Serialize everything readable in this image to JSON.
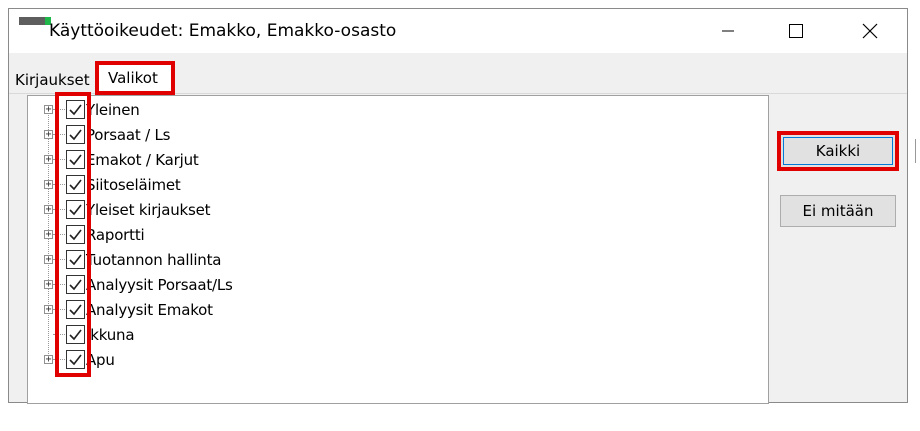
{
  "window": {
    "title": "Käyttöoikeudet: Emakko, Emakko-osasto",
    "buttons": {
      "minimize_icon": "minimize-icon",
      "maximize_icon": "maximize-icon",
      "close_icon": "close-icon"
    }
  },
  "tabs": [
    {
      "label": "Kirjaukset",
      "active": false
    },
    {
      "label": "Valikot",
      "active": true
    }
  ],
  "tree": {
    "items": [
      {
        "label": "Yleinen",
        "checked": true,
        "expandable": true
      },
      {
        "label": "Porsaat / Ls",
        "checked": true,
        "expandable": true
      },
      {
        "label": "Emakot / Karjut",
        "checked": true,
        "expandable": true
      },
      {
        "label": "Siitoseläimet",
        "checked": true,
        "expandable": true
      },
      {
        "label": "Yleiset kirjaukset",
        "checked": true,
        "expandable": true
      },
      {
        "label": "Raportti",
        "checked": true,
        "expandable": true
      },
      {
        "label": "Tuotannon hallinta",
        "checked": true,
        "expandable": true
      },
      {
        "label": "Analyysit Porsaat/Ls",
        "checked": true,
        "expandable": true
      },
      {
        "label": "Analyysit Emakot",
        "checked": true,
        "expandable": true
      },
      {
        "label": "Ikkuna",
        "checked": true,
        "expandable": false
      },
      {
        "label": "Apu",
        "checked": true,
        "expandable": true
      }
    ]
  },
  "actions": {
    "kaikki_label": "Kaikki",
    "ei_mitaan_label": "Ei mitään"
  },
  "colors": {
    "highlight": "#e00000",
    "title_icon_green": "#1fb64a"
  }
}
